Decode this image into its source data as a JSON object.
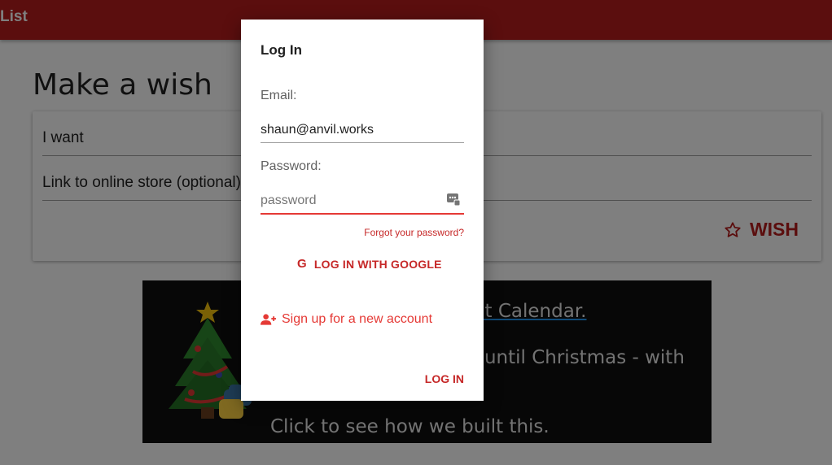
{
  "app": {
    "title": "List"
  },
  "page": {
    "heading": "Make a wish"
  },
  "form": {
    "want_label": "I want",
    "link_label": "Link to online store (optional)",
    "wish_button": "WISH"
  },
  "banner": {
    "line1": "Part of the Anvil Advent Calendar.",
    "line2": "Build a web app a day until Christmas - with nothing but Python!",
    "line3": "Click to see how we built this."
  },
  "modal": {
    "title": "Log In",
    "email_label": "Email:",
    "email_value": "shaun@anvil.works",
    "password_label": "Password:",
    "password_placeholder": "password",
    "forgot_link": "Forgot your password?",
    "google_button": "LOG IN WITH GOOGLE",
    "google_glyph": "G",
    "signup_link": "Sign up for a new account",
    "login_button": "LOG IN"
  },
  "colors": {
    "brand": "#b71c1c",
    "accent": "#e53935",
    "scrim": "rgba(0,0,0,0.5)"
  },
  "icons": {
    "wish": "star-outline-icon",
    "password": "password-manager-icon",
    "google": "google-icon",
    "signup": "add-user-icon"
  }
}
